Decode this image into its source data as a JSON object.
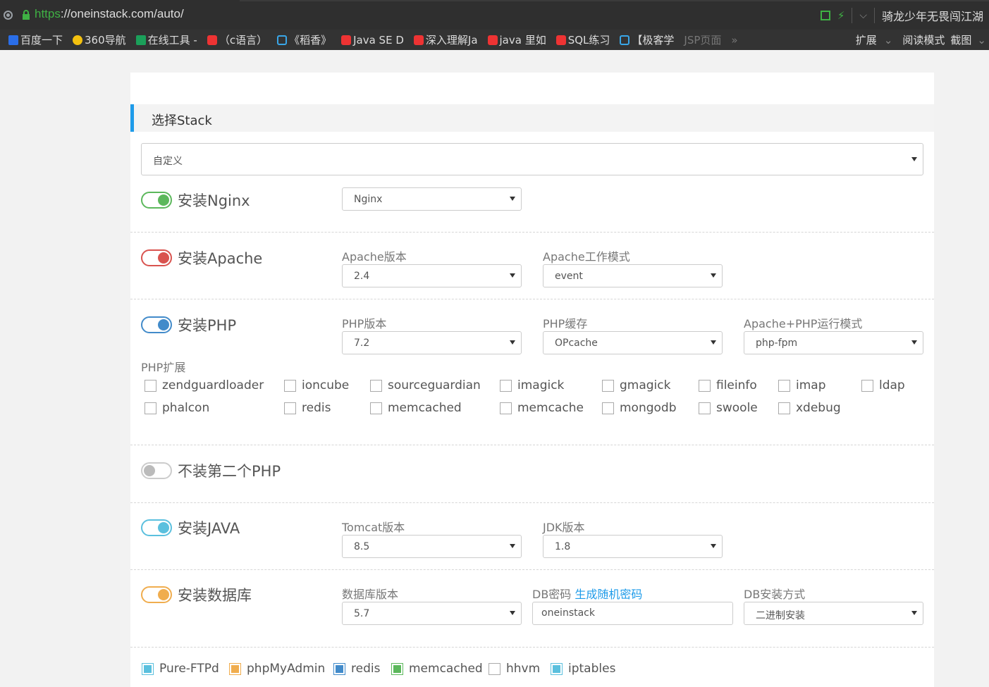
{
  "browser": {
    "url_scheme": "https",
    "url_rest": "://oneinstack.com/auto/",
    "profile_name": "骑龙少年无畏闯江湖",
    "bookmarks": [
      {
        "label": "百度一下",
        "icon": "baidu-icon"
      },
      {
        "label": "360导航",
        "icon": "360-icon"
      },
      {
        "label": "在线工具 -",
        "icon": "tool-icon"
      },
      {
        "label": "（c语言）",
        "icon": "csdn-icon"
      },
      {
        "label": "《稻香》",
        "icon": "bilibili-icon"
      },
      {
        "label": "Java SE D",
        "icon": "java-icon"
      },
      {
        "label": "深入理解Ja",
        "icon": "csdn-icon"
      },
      {
        "label": "java 里如",
        "icon": "csdn-icon"
      },
      {
        "label": "SQL练习",
        "icon": "csdn-icon"
      },
      {
        "label": "【极客学",
        "icon": "bilibili-icon"
      },
      {
        "label": "JSP页面",
        "icon": "page-icon"
      }
    ],
    "more_label": "»",
    "ext_label": "扩展",
    "read_label": "阅读模式",
    "shot_label": "截图"
  },
  "form": {
    "section_title": "选择Stack",
    "stack_select": "自定义",
    "nginx": {
      "label": "安装Nginx",
      "select": "Nginx",
      "color": "#5cb85c"
    },
    "apache": {
      "label": "安装Apache",
      "color": "#d9534f",
      "version_label": "Apache版本",
      "version": "2.4",
      "mode_label": "Apache工作模式",
      "mode": "event"
    },
    "php": {
      "label": "安装PHP",
      "color": "#428bca",
      "version_label": "PHP版本",
      "version": "7.2",
      "cache_label": "PHP缓存",
      "cache": "OPcache",
      "run_label": "Apache+PHP运行模式",
      "run": "php-fpm",
      "ext_label": "PHP扩展",
      "extensions": [
        [
          "zendguardloader",
          "ioncube",
          "sourceguardian",
          "imagick",
          "gmagick",
          "fileinfo",
          "imap",
          "ldap"
        ],
        [
          "phalcon",
          "redis",
          "memcached",
          "memcache",
          "mongodb",
          "swoole",
          "xdebug"
        ]
      ]
    },
    "php2": {
      "label": "不装第二个PHP",
      "color": "#bbbbbb"
    },
    "java": {
      "label": "安装JAVA",
      "color": "#5bc0de",
      "tomcat_label": "Tomcat版本",
      "tomcat": "8.5",
      "jdk_label": "JDK版本",
      "jdk": "1.8"
    },
    "db": {
      "label": "安装数据库",
      "color": "#f0ad4e",
      "version_label": "数据库版本",
      "version": "5.7",
      "pwd_label": "DB密码",
      "pwd_link": "生成随机密码",
      "pwd": "oneinstack",
      "install_label": "DB安装方式",
      "install": "二进制安装"
    },
    "extras": [
      {
        "label": "Pure-FTPd",
        "color": "#5bc0de"
      },
      {
        "label": "phpMyAdmin",
        "color": "#f0ad4e"
      },
      {
        "label": "redis",
        "color": "#428bca"
      },
      {
        "label": "memcached",
        "color": "#5cb85c"
      },
      {
        "label": "hhvm",
        "color": ""
      },
      {
        "label": "iptables",
        "color": "#5bc0de"
      }
    ]
  }
}
